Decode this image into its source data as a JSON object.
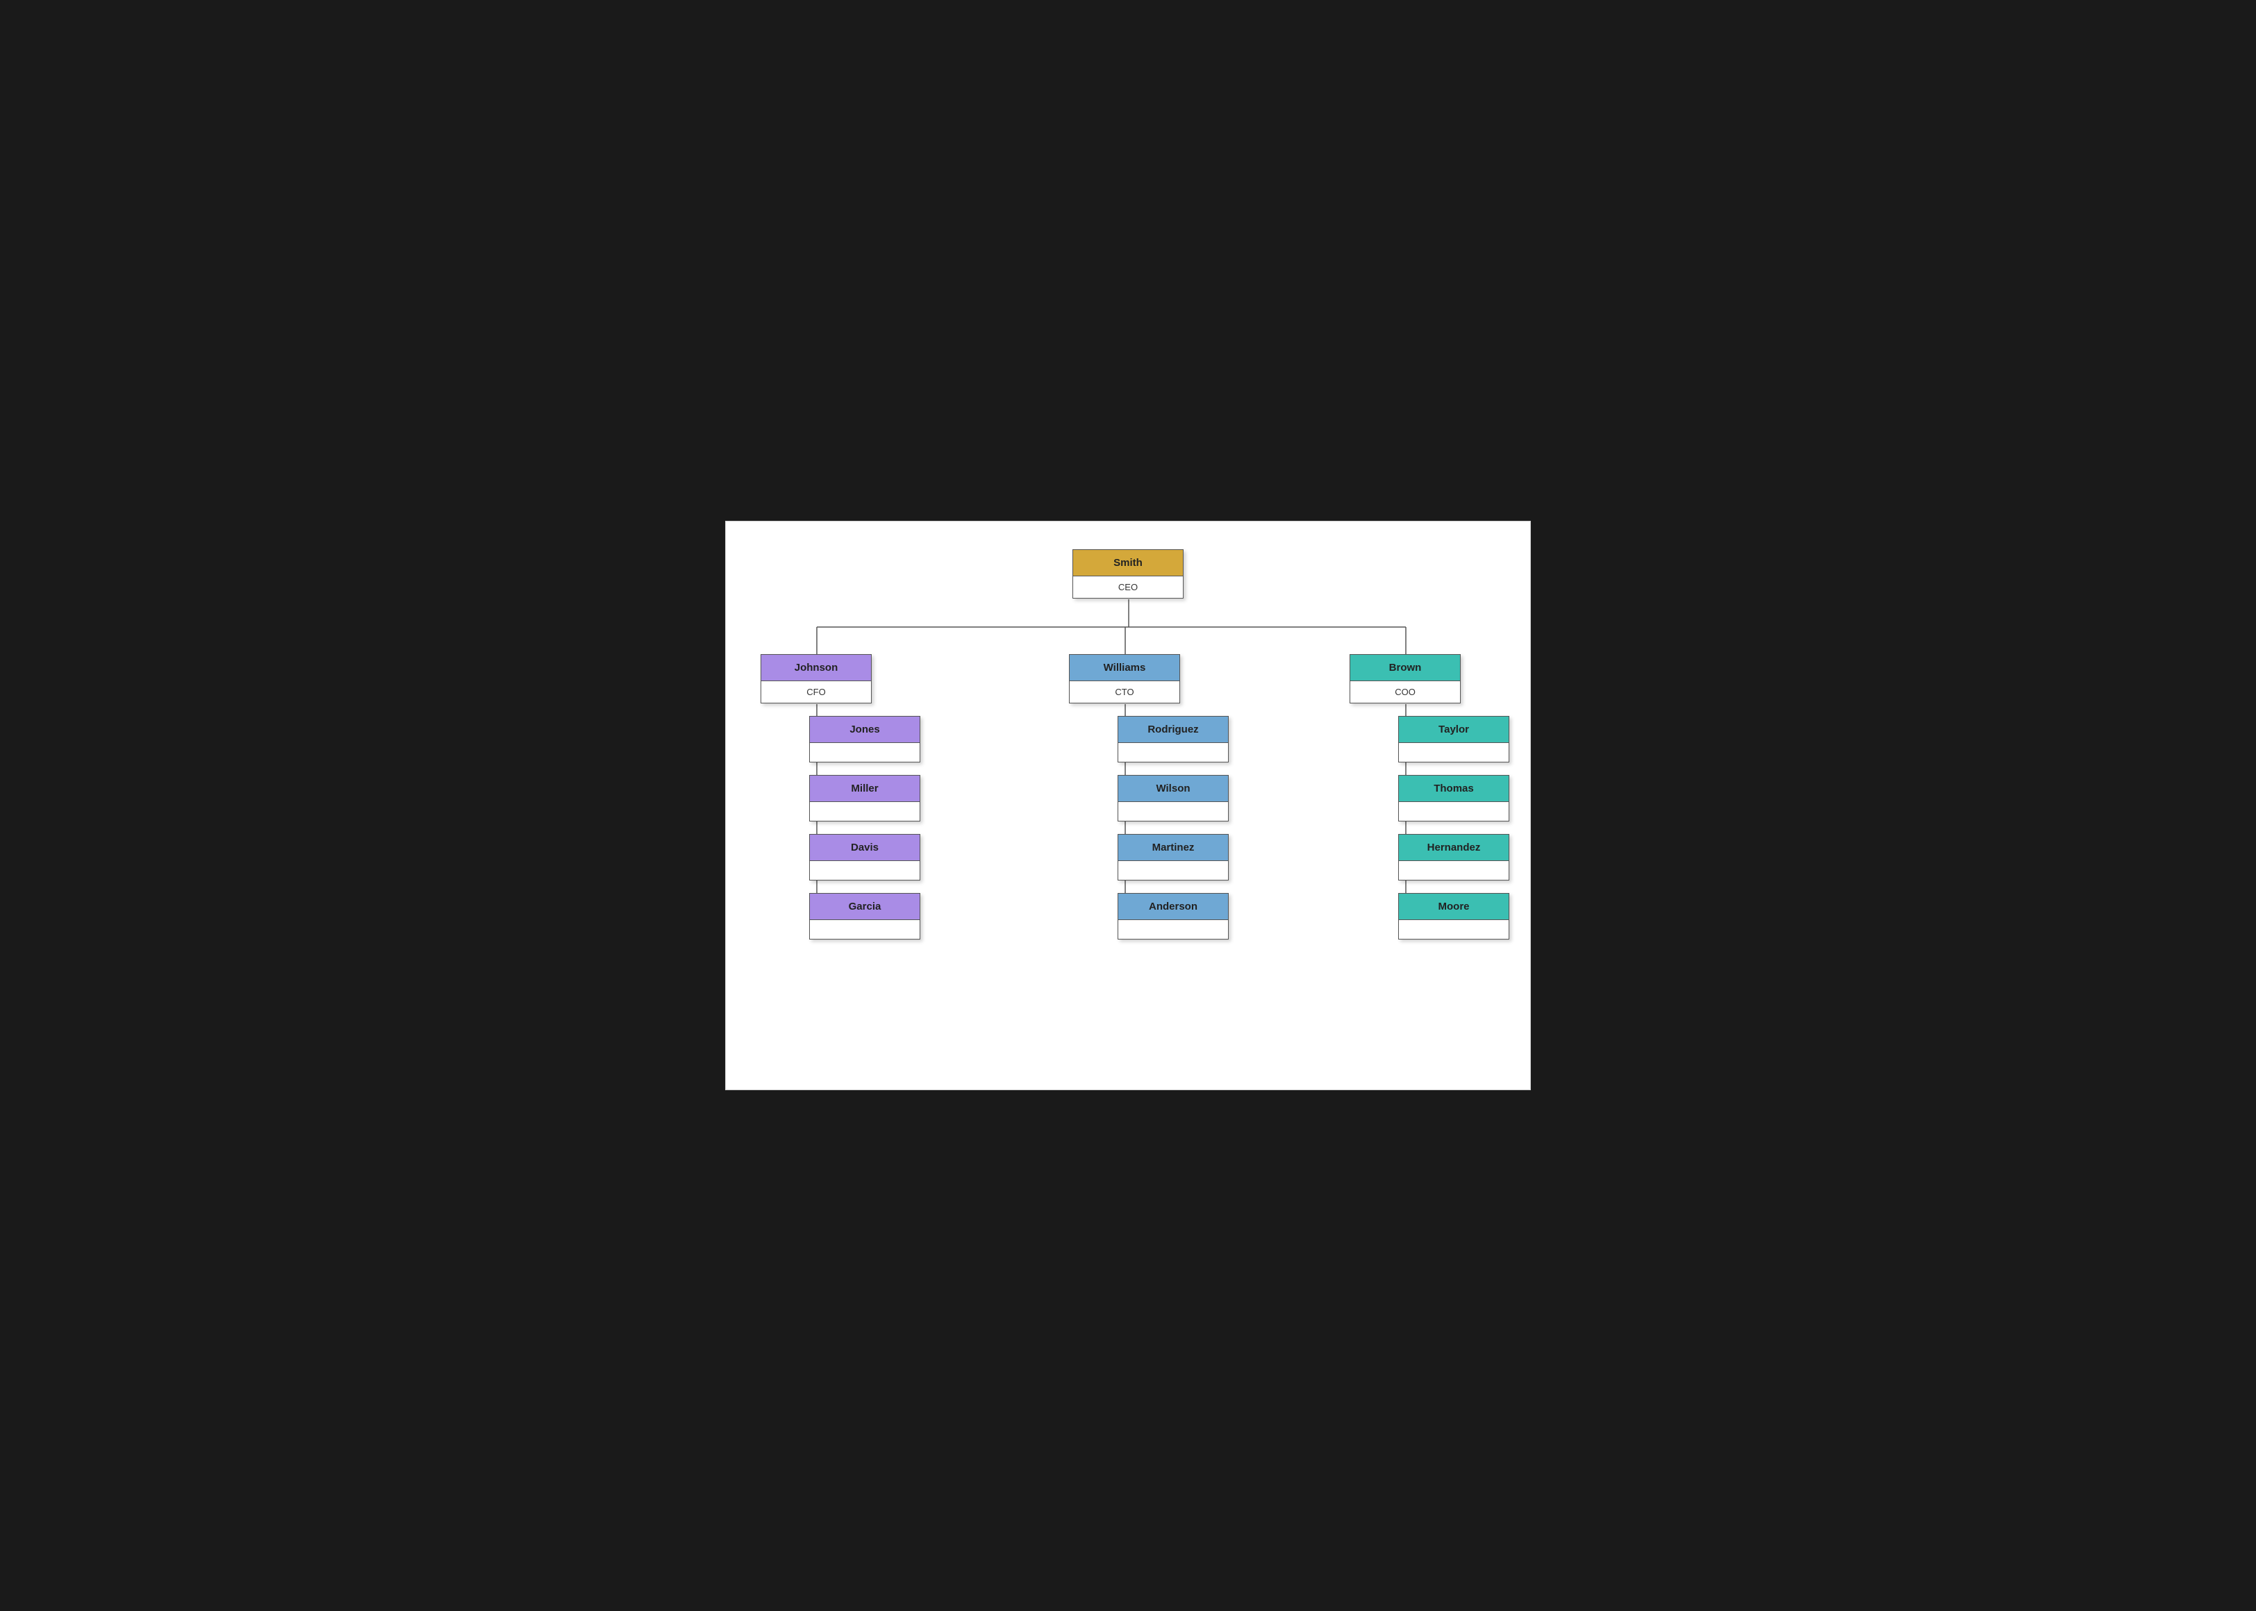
{
  "chart": {
    "root": {
      "name": "Smith",
      "title": "CEO",
      "color": "gold"
    },
    "level1": [
      {
        "name": "Johnson",
        "title": "CFO",
        "color": "purple",
        "children": [
          {
            "name": "Jones",
            "title": "",
            "color": "purple"
          },
          {
            "name": "Miller",
            "title": "",
            "color": "purple"
          },
          {
            "name": "Davis",
            "title": "",
            "color": "purple"
          },
          {
            "name": "Garcia",
            "title": "",
            "color": "purple"
          }
        ]
      },
      {
        "name": "Williams",
        "title": "CTO",
        "color": "blue",
        "children": [
          {
            "name": "Rodriguez",
            "title": "",
            "color": "blue"
          },
          {
            "name": "Wilson",
            "title": "",
            "color": "blue"
          },
          {
            "name": "Martinez",
            "title": "",
            "color": "blue"
          },
          {
            "name": "Anderson",
            "title": "",
            "color": "blue"
          }
        ]
      },
      {
        "name": "Brown",
        "title": "COO",
        "color": "teal",
        "children": [
          {
            "name": "Taylor",
            "title": "",
            "color": "teal"
          },
          {
            "name": "Thomas",
            "title": "",
            "color": "teal"
          },
          {
            "name": "Hernandez",
            "title": "",
            "color": "teal"
          },
          {
            "name": "Moore",
            "title": "",
            "color": "teal"
          }
        ]
      }
    ]
  }
}
